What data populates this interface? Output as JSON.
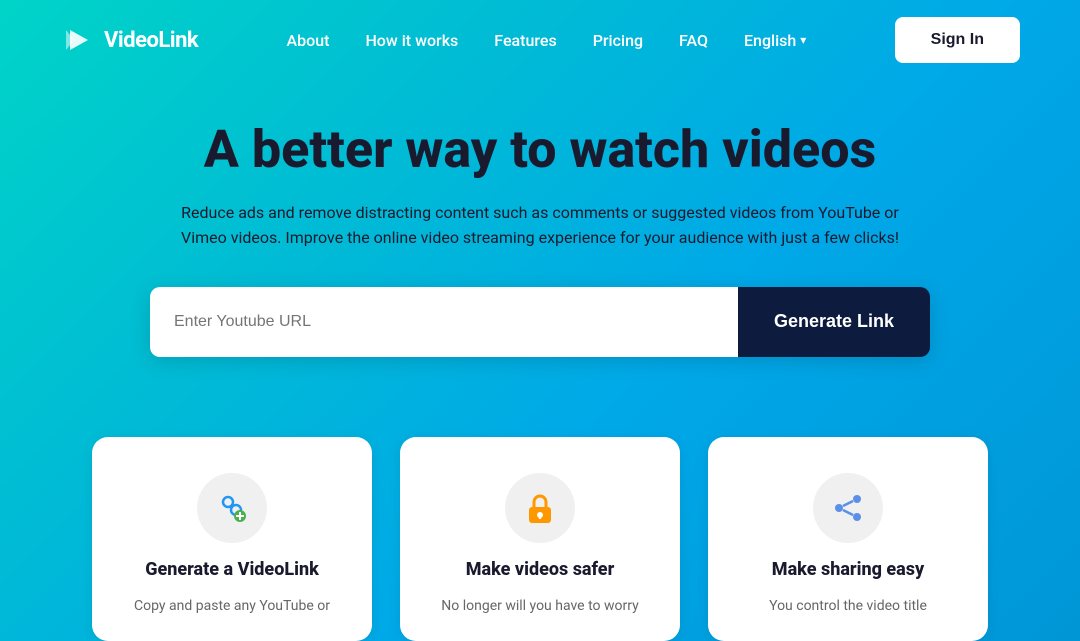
{
  "brand": {
    "name": "VideoLink",
    "logo_alt": "VideoLink logo"
  },
  "navbar": {
    "links": [
      {
        "label": "About",
        "key": "about"
      },
      {
        "label": "How it works",
        "key": "how-it-works"
      },
      {
        "label": "Features",
        "key": "features"
      },
      {
        "label": "Pricing",
        "key": "pricing"
      },
      {
        "label": "FAQ",
        "key": "faq"
      }
    ],
    "language": "English",
    "signin_label": "Sign In"
  },
  "hero": {
    "title": "A better way to watch videos",
    "subtitle": "Reduce ads and remove distracting content such as comments or suggested videos from YouTube or Vimeo videos. Improve the online video streaming experience for your audience with just a few clicks!",
    "input_placeholder": "Enter Youtube URL",
    "cta_label": "Generate Link"
  },
  "features": [
    {
      "key": "generate-videolink",
      "icon": "🔗",
      "icon_type": "link",
      "title": "Generate a VideoLink",
      "description": "Copy and paste any YouTube or"
    },
    {
      "key": "make-safer",
      "icon": "🔒",
      "icon_type": "lock",
      "title": "Make videos safer",
      "description": "No longer will you have to worry"
    },
    {
      "key": "make-sharing",
      "icon": "🔁",
      "icon_type": "share",
      "title": "Make sharing easy",
      "description": "You control the video title"
    }
  ]
}
